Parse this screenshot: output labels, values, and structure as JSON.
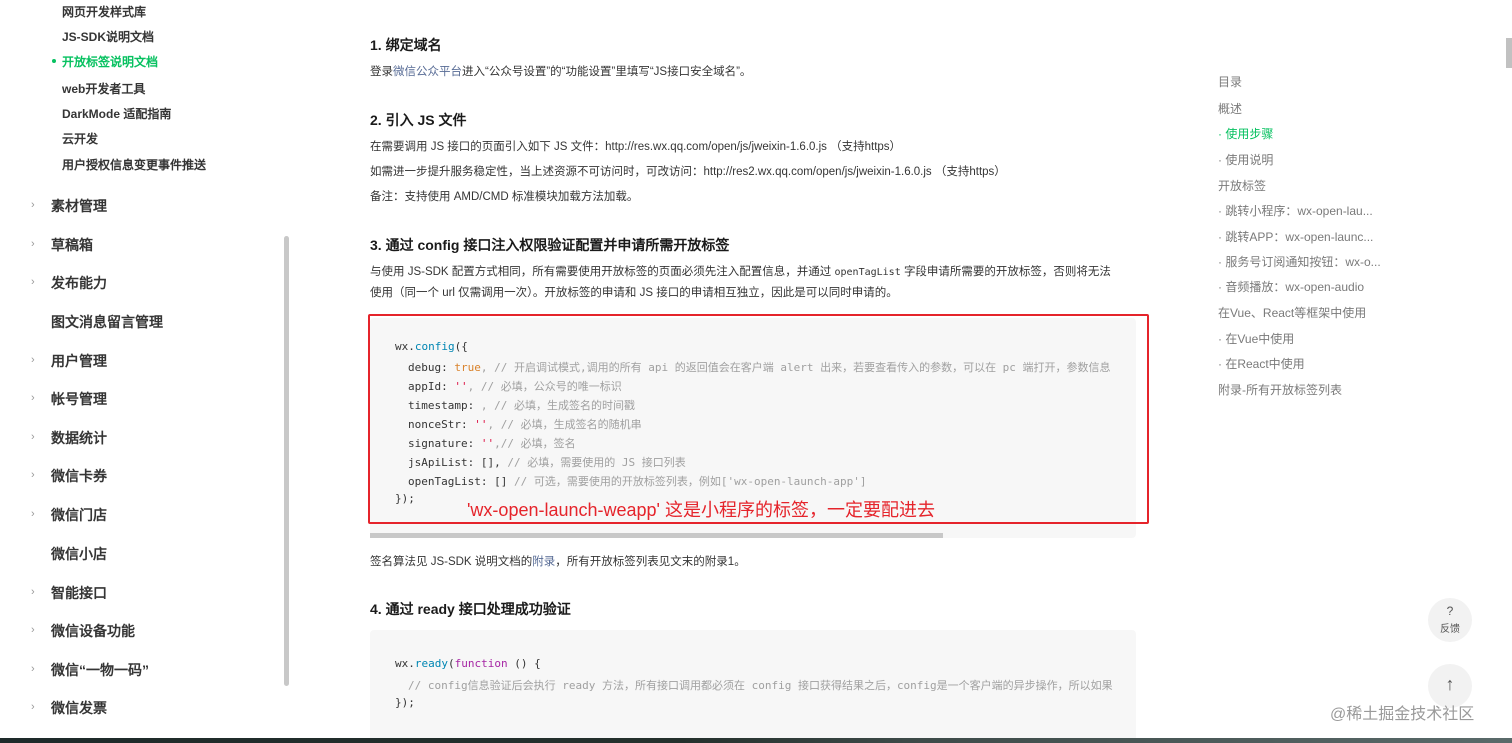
{
  "sidebar": {
    "sub_items": [
      {
        "label": "网页开发样式库",
        "active": false
      },
      {
        "label": "JS-SDK说明文档",
        "active": false
      },
      {
        "label": "开放标签说明文档",
        "active": true
      },
      {
        "label": "web开发者工具",
        "active": false
      },
      {
        "label": "DarkMode 适配指南",
        "active": false
      },
      {
        "label": "云开发",
        "active": false
      },
      {
        "label": "用户授权信息变更事件推送",
        "active": false
      }
    ],
    "nav_items": [
      {
        "label": "素材管理",
        "has_chevron": true
      },
      {
        "label": "草稿箱",
        "has_chevron": true
      },
      {
        "label": "发布能力",
        "has_chevron": true
      },
      {
        "label": "图文消息留言管理",
        "has_chevron": false
      },
      {
        "label": "用户管理",
        "has_chevron": true
      },
      {
        "label": "帐号管理",
        "has_chevron": true
      },
      {
        "label": "数据统计",
        "has_chevron": true
      },
      {
        "label": "微信卡券",
        "has_chevron": true
      },
      {
        "label": "微信门店",
        "has_chevron": true
      },
      {
        "label": "微信小店",
        "has_chevron": false
      },
      {
        "label": "智能接口",
        "has_chevron": true
      },
      {
        "label": "微信设备功能",
        "has_chevron": true
      },
      {
        "label": "微信“一物一码”",
        "has_chevron": true
      },
      {
        "label": "微信发票",
        "has_chevron": true
      }
    ]
  },
  "content": {
    "sec1_title": "1. 绑定域名",
    "sec1_p_a": "登录",
    "sec1_p_link": "微信公众平台",
    "sec1_p_b": "进入“公众号设置”的“功能设置”里填写“JS接口安全域名”。",
    "sec2_title": "2. 引入 JS 文件",
    "sec2_p1": "在需要调用 JS 接口的页面引入如下 JS 文件：http://res.wx.qq.com/open/js/jweixin-1.6.0.js （支持https）",
    "sec2_p2": "如需进一步提升服务稳定性，当上述资源不可访问时，可改访问：http://res2.wx.qq.com/open/js/jweixin-1.6.0.js （支持https）",
    "sec2_p3": "备注：支持使用 AMD/CMD 标准模块加载方法加载。",
    "sec3_title": "3. 通过 config 接口注入权限验证配置并申请所需开放标签",
    "sec3_p1_a": "与使用 JS-SDK 配置方式相同，所有需要使用开放标签的页面必须先注入配置信息，并通过",
    "sec3_p1_code": "openTagList",
    "sec3_p1_b": "字段申请所需要的开放标签，否则将无法",
    "sec3_p2": "使用（同一个 url 仅需调用一次）。开放标签的申请和 JS 接口的申请相互独立，因此是可以同时申请的。",
    "code1": {
      "l1_obj": "wx.",
      "l1_fn": "config",
      "l1_end": "({",
      "l2_key": "debug: ",
      "l2_val": "true",
      "l2_cm": ", // 开启调试模式,调用的所有 api 的返回值会在客户端 alert 出来，若要查看传入的参数，可以在 pc 端打开，参数信息",
      "l3_key": "appId: ",
      "l3_val": "''",
      "l3_cm": ", // 必填，公众号的唯一标识",
      "l4_key": "timestamp: ",
      "l4_cm": ", // 必填，生成签名的时间戳",
      "l5_key": "nonceStr: ",
      "l5_val": "''",
      "l5_cm": ", // 必填，生成签名的随机串",
      "l6_key": "signature: ",
      "l6_val": "''",
      "l6_cm": ",// 必填，签名",
      "l7_key": "jsApiList: [],",
      "l7_cm": " // 必填，需要使用的 JS 接口列表",
      "l8_key": "openTagList: []",
      "l8_cm": " // 可选，需要使用的开放标签列表，例如['wx-open-launch-app']",
      "l9": "});"
    },
    "annotation": "'wx-open-launch-weapp'  这是小程序的标签，一定要配进去",
    "after_code_a": "签名算法见 JS-SDK 说明文档的",
    "after_code_link": "附录",
    "after_code_b": "，所有开放标签列表见文末的附录1。",
    "sec4_title": "4. 通过 ready 接口处理成功验证",
    "code2": {
      "l1_obj": "wx.",
      "l1_fn": "ready",
      "l1_paren": "(",
      "l1_kw": "function",
      "l1_end": " () {",
      "l2_cm": "// config信息验证后会执行 ready 方法，所有接口调用都必须在 config 接口获得结果之后，config是一个客户端的异步操作，所以如果",
      "l3": "});"
    }
  },
  "toc": {
    "items": [
      {
        "label": "目录",
        "active": false
      },
      {
        "label": "概述",
        "active": false
      },
      {
        "label": "· 使用步骤",
        "active": true
      },
      {
        "label": "· 使用说明",
        "active": false
      },
      {
        "label": "开放标签",
        "active": false
      },
      {
        "label": "· 跳转小程序：wx-open-lau...",
        "active": false
      },
      {
        "label": "· 跳转APP：wx-open-launc...",
        "active": false
      },
      {
        "label": "· 服务号订阅通知按钮：wx-o...",
        "active": false
      },
      {
        "label": "· 音频播放：wx-open-audio",
        "active": false
      },
      {
        "label": "在Vue、React等框架中使用",
        "active": false
      },
      {
        "label": "· 在Vue中使用",
        "active": false
      },
      {
        "label": "· 在React中使用",
        "active": false
      },
      {
        "label": "附录-所有开放标签列表",
        "active": false
      }
    ]
  },
  "float_buttons": {
    "feedback_glyph": "?",
    "feedback_label": "反馈",
    "top_glyph": "↑"
  },
  "watermark": "@稀土掘金技术社区",
  "colors": {
    "accent": "#07c160",
    "link": "#576b95",
    "annotation": "#e5242b"
  }
}
